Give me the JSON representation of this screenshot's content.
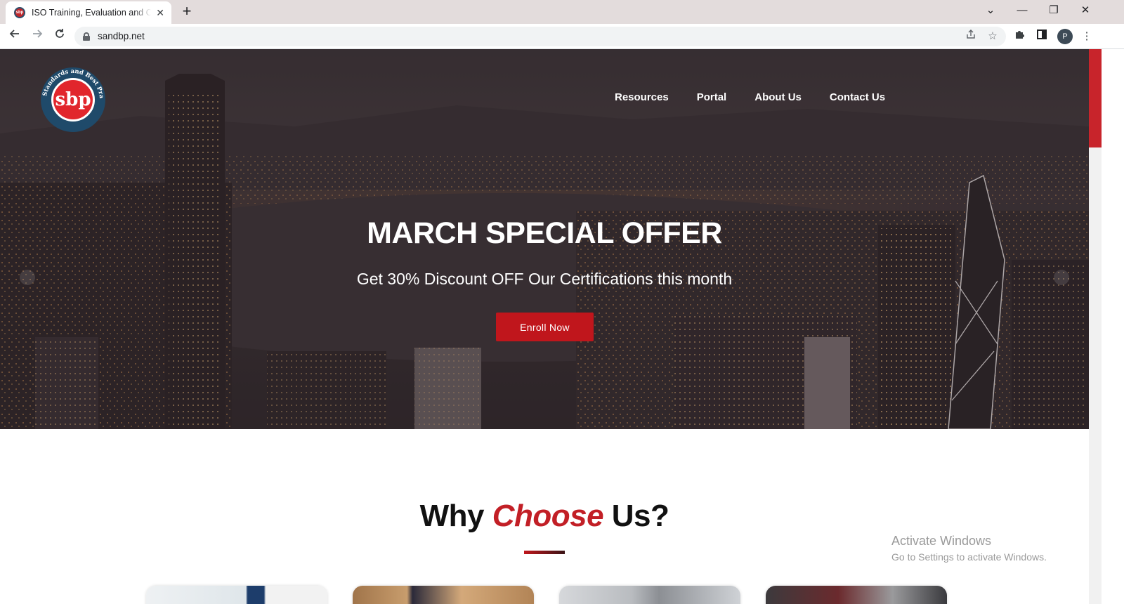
{
  "browser": {
    "tab_title": "ISO Training, Evaluation and Certification",
    "favicon_text": "sbp",
    "close_glyph": "✕",
    "new_tab_glyph": "+",
    "url": "sandbp.net",
    "profile_initial": "P",
    "window_controls": {
      "tab_search": "⌄",
      "minimize": "—",
      "restore": "❐",
      "close": "✕"
    }
  },
  "site": {
    "logo_text": "sbp",
    "logo_ring_text": "Standards and Best Practice",
    "nav": [
      {
        "label": "Resources"
      },
      {
        "label": "Portal"
      },
      {
        "label": "About Us"
      },
      {
        "label": "Contact Us"
      }
    ],
    "hero": {
      "title": "MARCH SPECIAL OFFER",
      "subtitle": "Get 30% Discount OFF Our Certifications this month",
      "cta": "Enroll Now"
    },
    "why": {
      "prefix": "Why ",
      "accent": "Choose",
      "suffix": " Us?"
    }
  },
  "os_watermark": {
    "title": "Activate Windows",
    "subtitle": "Go to Settings to activate Windows."
  },
  "colors": {
    "brand_red": "#c0161c",
    "accent_red": "#c21f26",
    "logo_blue": "#1f4a6a"
  }
}
